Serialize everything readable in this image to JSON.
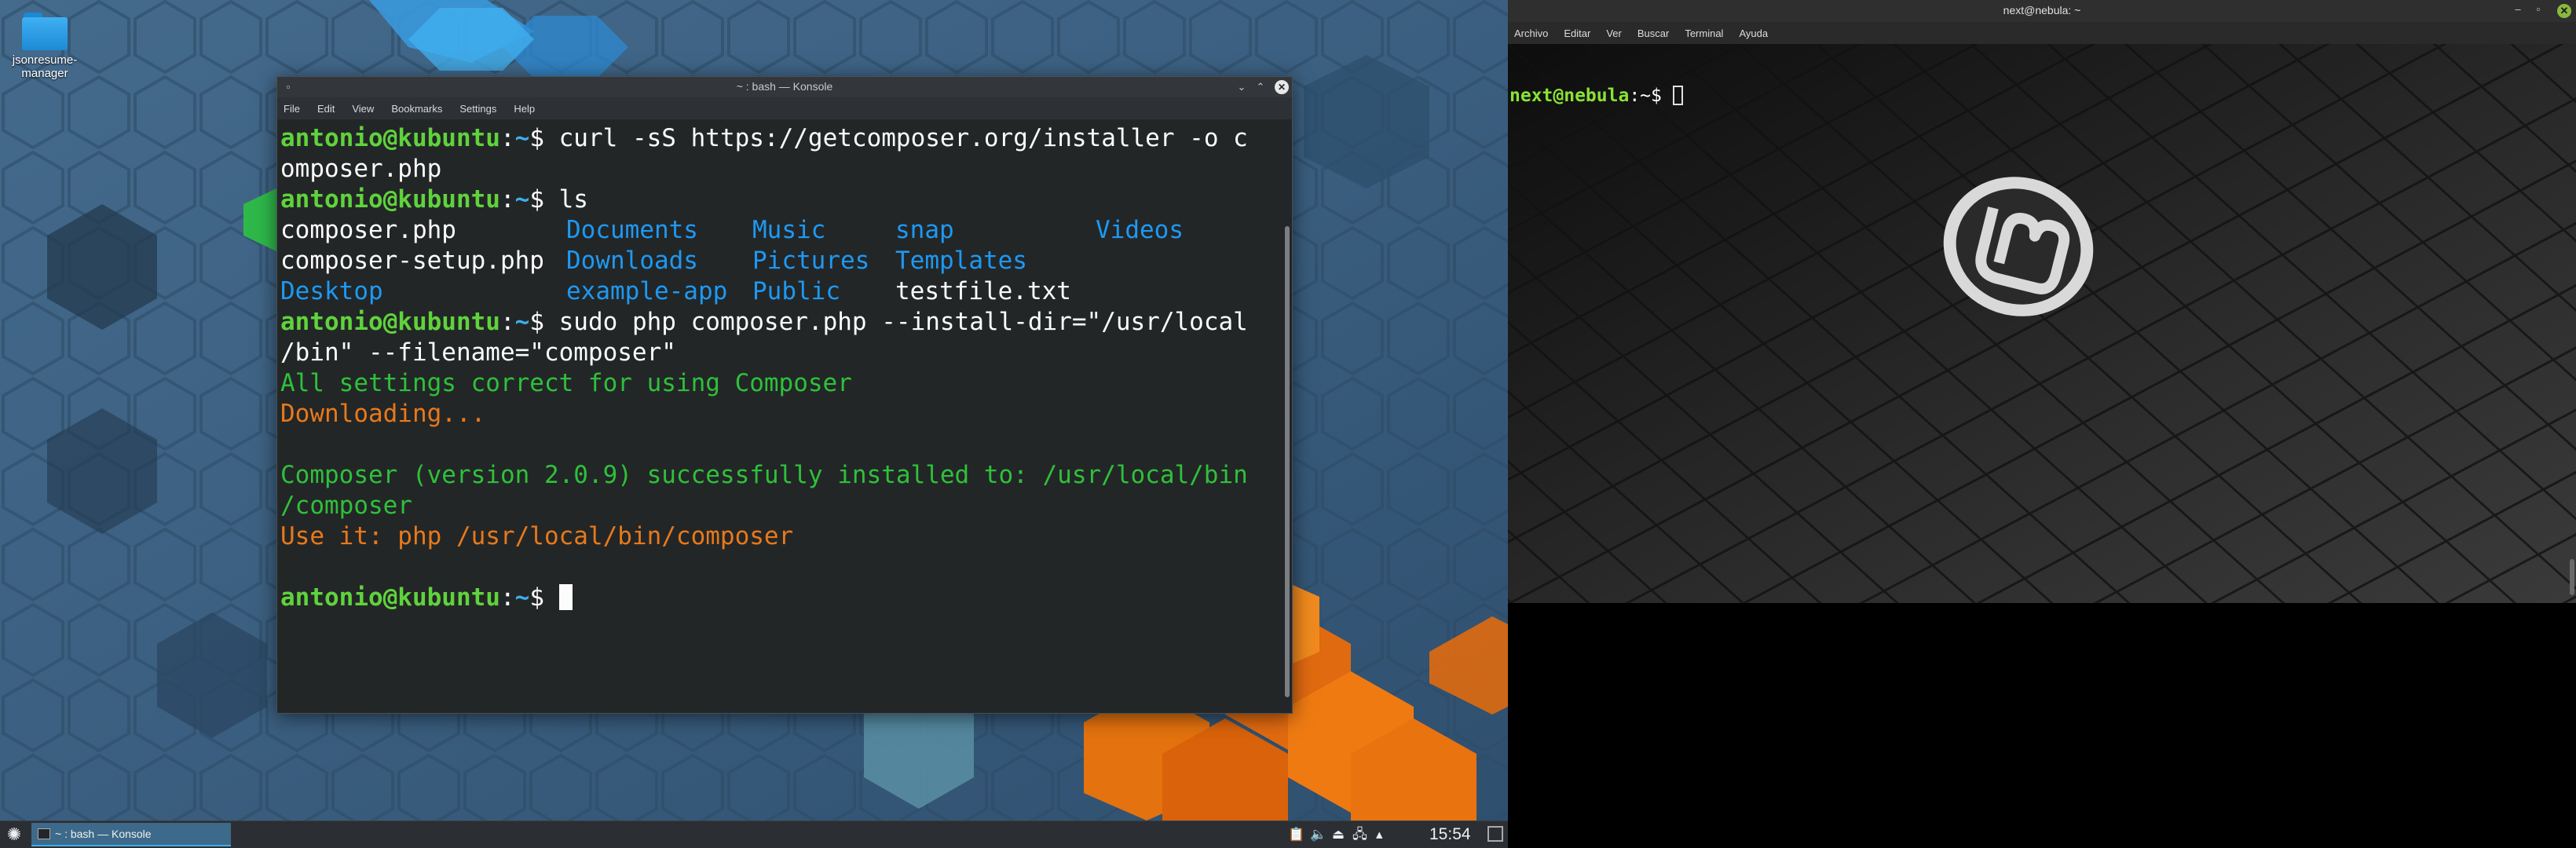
{
  "desktop": {
    "icon_label": "jsonresume-\nmanager"
  },
  "konsole": {
    "title": "~ : bash — Konsole",
    "menu": [
      "File",
      "Edit",
      "View",
      "Bookmarks",
      "Settings",
      "Help"
    ],
    "prompt_user": "antonio@kubuntu",
    "prompt_sep": ":",
    "prompt_path": "~",
    "prompt_end": "$ ",
    "cmd1_a": "curl -sS https://getcomposer.org/installer -o c",
    "cmd1_b": "omposer.php",
    "cmd2": "ls",
    "ls": {
      "r1": [
        "composer.php",
        "Documents",
        "Music",
        "snap",
        "Videos"
      ],
      "r2": [
        "composer-setup.php",
        "Downloads",
        "Pictures",
        "Templates"
      ],
      "r3": [
        "Desktop",
        "example-app",
        "Public",
        "testfile.txt"
      ]
    },
    "cmd3_a": "sudo php composer.php --install-dir=\"/usr/local",
    "cmd3_b": "/bin\" --filename=\"composer\"",
    "out1": "All settings correct for using Composer",
    "out2": "Downloading...",
    "out3_a": "Composer (version 2.0.9) successfully installed to: /usr/local/bin",
    "out3_b": "/composer",
    "out4": "Use it: php /usr/local/bin/composer"
  },
  "panel": {
    "task_label": "~ : bash — Konsole",
    "clock": "15:54"
  },
  "mint": {
    "title": "next@nebula: ~",
    "menu": [
      "Archivo",
      "Editar",
      "Ver",
      "Buscar",
      "Terminal",
      "Ayuda"
    ],
    "prompt_user": "next@nebula",
    "prompt_path": ":~$ "
  }
}
